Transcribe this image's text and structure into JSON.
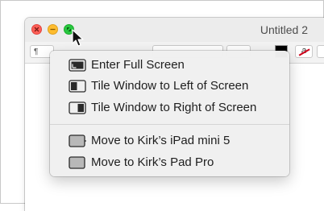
{
  "window": {
    "title": "Untitled 2"
  },
  "toolbar": {
    "paragraph_symbol": "¶",
    "highlight_letter": "a",
    "text_color": "#000000"
  },
  "menu": {
    "items": [
      {
        "label": "Enter Full Screen",
        "icon": "enter-full-screen-icon"
      },
      {
        "label": "Tile Window to Left of Screen",
        "icon": "tile-left-icon"
      },
      {
        "label": "Tile Window to Right of Screen",
        "icon": "tile-right-icon"
      }
    ],
    "devices": [
      {
        "label": "Move to Kirk’s iPad mini 5",
        "icon": "ipad-mini-icon"
      },
      {
        "label": "Move to Kirk’s Pad Pro",
        "icon": "ipad-pro-icon"
      }
    ]
  },
  "colors": {
    "close": "#fe5f57",
    "minimize": "#febc2e",
    "zoom": "#28c840",
    "menu_background": "#f0f0f0"
  }
}
